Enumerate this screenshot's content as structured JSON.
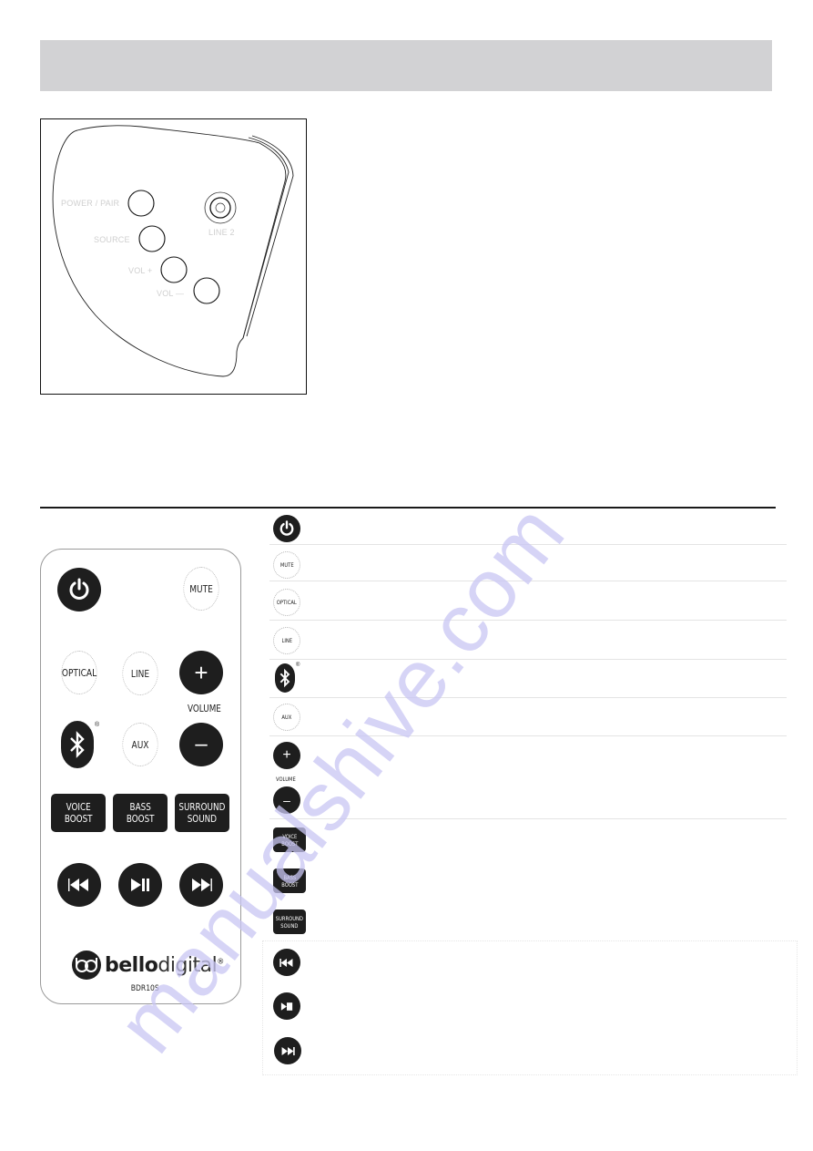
{
  "header": {
    "title": ""
  },
  "speaker_diagram": {
    "labels": {
      "power_pair": "POWER / PAIR",
      "source": "SOURCE",
      "vol_plus": "VOL +",
      "vol_minus": "VOL —",
      "line2": "LINE 2"
    }
  },
  "remote": {
    "buttons": {
      "power_icon": "power-icon",
      "mute": "MUTE",
      "optical": "OPTICAL",
      "line": "LINE",
      "vol_up": "+",
      "volume": "VOLUME",
      "vol_down": "–",
      "bluetooth_icon": "bluetooth-icon",
      "registered": "®",
      "aux": "AUX",
      "voice_boost": "VOICE\nBOOST",
      "bass_boost": "BASS\nBOOST",
      "surround_sound": "SURROUND\nSOUND",
      "prev_icon": "skip-previous-icon",
      "play_pause_icon": "play-pause-icon",
      "next_icon": "skip-next-icon"
    },
    "brand": {
      "bold": "bello",
      "thin": "digital",
      "registered": "®"
    },
    "model": "BDR10S"
  },
  "key_list": {
    "items": [
      {
        "id": "power",
        "icon": "power-icon"
      },
      {
        "id": "mute",
        "label": "MUTE"
      },
      {
        "id": "optical",
        "label": "OPTICAL"
      },
      {
        "id": "line",
        "label": "LINE"
      },
      {
        "id": "bluetooth",
        "icon": "bluetooth-icon",
        "registered": "®"
      },
      {
        "id": "aux",
        "label": "AUX"
      },
      {
        "id": "volume",
        "plus": "+",
        "label": "VOLUME",
        "minus": "–"
      },
      {
        "id": "voice_boost",
        "label": "VOICE\nBOOST"
      },
      {
        "id": "bass_boost",
        "label": "BASS\nBOOST"
      },
      {
        "id": "surround_sound",
        "label": "SURROUND\nSOUND"
      },
      {
        "id": "previous",
        "icon": "skip-previous-icon"
      },
      {
        "id": "play_pause",
        "icon": "play-pause-icon"
      },
      {
        "id": "next",
        "icon": "skip-next-icon"
      }
    ]
  },
  "watermark": "manualshive.com",
  "colors": {
    "header_bg": "#d2d2d4",
    "button_dark": "#1e1e1e",
    "watermark": "#c9c6f4"
  }
}
